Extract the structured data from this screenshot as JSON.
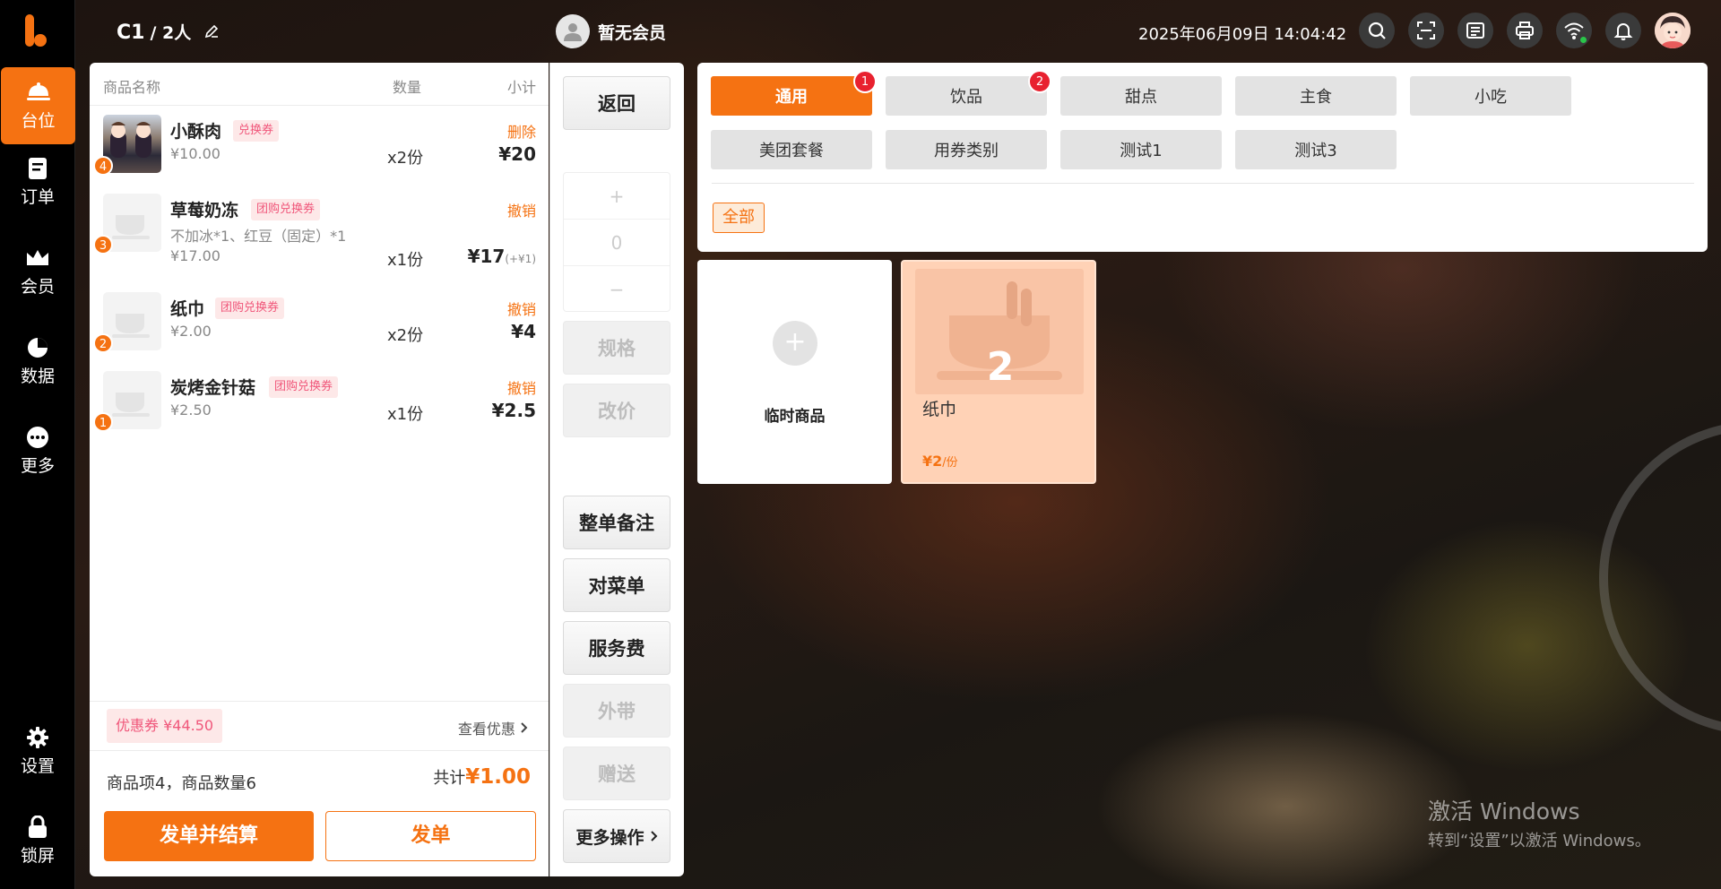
{
  "sidebar": {
    "items": [
      {
        "label": "台位",
        "icon": "dining-icon"
      },
      {
        "label": "订单",
        "icon": "order-icon"
      },
      {
        "label": "会员",
        "icon": "crown-icon"
      },
      {
        "label": "数据",
        "icon": "pie-chart-icon"
      },
      {
        "label": "更多",
        "icon": "more-icon"
      },
      {
        "label": "设置",
        "icon": "gear-icon"
      },
      {
        "label": "锁屏",
        "icon": "lock-icon"
      }
    ]
  },
  "header": {
    "table": "C1",
    "guests": "/ 2人",
    "member": "暂无会员",
    "datetime": "2025年06月09日 14:04:42"
  },
  "order": {
    "columns": {
      "name": "商品名称",
      "qty": "数量",
      "subtotal": "小计"
    },
    "items": [
      {
        "index": "4",
        "name": "小酥肉",
        "tag": "兑换券",
        "note": "",
        "price": "¥10.00",
        "qty": "x2份",
        "action": "删除",
        "subtotal": "¥20",
        "extra": ""
      },
      {
        "index": "3",
        "name": "草莓奶冻",
        "tag": "团购兑换券",
        "note": "不加冰*1、红豆（固定）*1",
        "price": "¥17.00",
        "qty": "x1份",
        "action": "撤销",
        "subtotal": "¥17",
        "extra": "(+¥1)"
      },
      {
        "index": "2",
        "name": "纸巾",
        "tag": "团购兑换券",
        "note": "",
        "price": "¥2.00",
        "qty": "x2份",
        "action": "撤销",
        "subtotal": "¥4",
        "extra": ""
      },
      {
        "index": "1",
        "name": "炭烤金针菇",
        "tag": "团购兑换券",
        "note": "",
        "price": "¥2.50",
        "qty": "x1份",
        "action": "撤销",
        "subtotal": "¥2.5",
        "extra": ""
      }
    ],
    "coupon": "优惠券 ¥44.50",
    "view_discount": "查看优惠",
    "summary": "商品项4，商品数量6",
    "total_label": "共计",
    "total_value": "¥1.00",
    "settle_button": "发单并结算",
    "send_button": "发单"
  },
  "actions": {
    "back": "返回",
    "plus": "+",
    "qty": "0",
    "minus": "−",
    "spec": "规格",
    "change_price": "改价",
    "order_note": "整单备注",
    "check_menu": "对菜单",
    "service_fee": "服务费",
    "takeout": "外带",
    "gift": "赠送",
    "more": "更多操作"
  },
  "categories": {
    "row1": [
      {
        "label": "通用",
        "badge": "1"
      },
      {
        "label": "饮品",
        "badge": "2"
      },
      {
        "label": "甜点",
        "badge": ""
      },
      {
        "label": "主食",
        "badge": ""
      },
      {
        "label": "小吃",
        "badge": ""
      }
    ],
    "row2": [
      {
        "label": "美团套餐"
      },
      {
        "label": "用券类别"
      },
      {
        "label": "测试1"
      },
      {
        "label": "测试3"
      }
    ],
    "sub_all": "全部"
  },
  "products": {
    "temp_label": "临时商品",
    "temp_plus": "+",
    "item": {
      "name": "纸巾",
      "count": "2",
      "price": "¥2",
      "unit": "/份"
    }
  },
  "watermark": {
    "line1": "激活 Windows",
    "line2": "转到“设置”以激活 Windows。"
  },
  "colors": {
    "accent": "#f57212",
    "badge_red": "#e8212f",
    "tag_pink": "#f0567a"
  }
}
